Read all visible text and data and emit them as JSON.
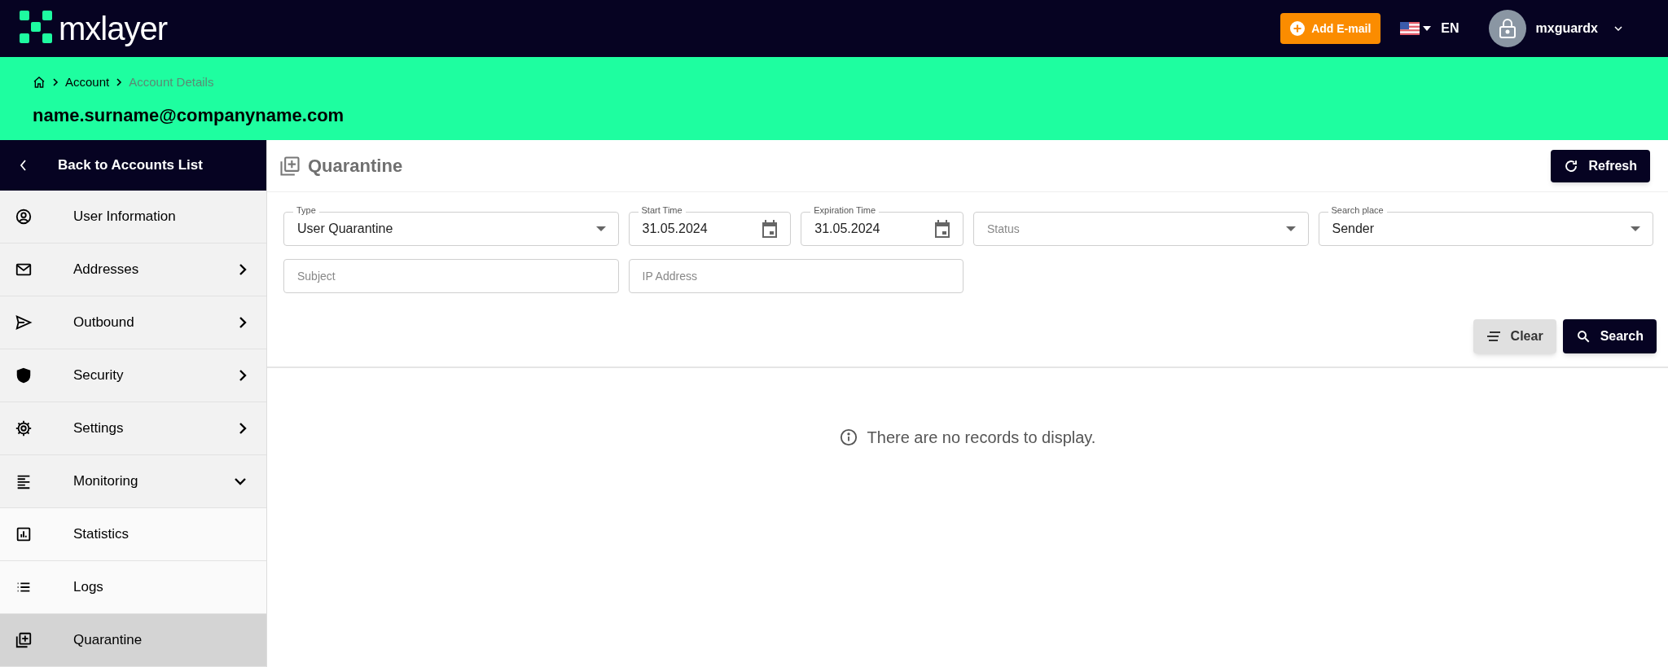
{
  "header": {
    "logo_text": "mxlayer",
    "add_email_button": "Add E-mail",
    "language": "EN",
    "user": "mxguardx"
  },
  "breadcrumb": [
    "Account",
    "Account Details"
  ],
  "account_email": "name.surname@companyname.com",
  "sidebar": {
    "back": "Back to Accounts List",
    "items": [
      {
        "label": "User Information",
        "kind": "plain",
        "selected": false
      },
      {
        "label": "Addresses",
        "kind": "submenu",
        "expanded": false,
        "selected": false
      },
      {
        "label": "Outbound",
        "kind": "submenu",
        "expanded": false,
        "selected": false
      },
      {
        "label": "Security",
        "kind": "submenu",
        "expanded": false,
        "selected": false
      },
      {
        "label": "Settings",
        "kind": "submenu",
        "expanded": false,
        "selected": false
      },
      {
        "label": "Monitoring",
        "kind": "submenu",
        "expanded": true,
        "selected": false,
        "children": [
          {
            "label": "Statistics",
            "selected": false
          },
          {
            "label": "Logs",
            "selected": false
          },
          {
            "label": "Quarantine",
            "selected": true
          }
        ]
      }
    ]
  },
  "page": {
    "title": "Quarantine",
    "refresh_button": "Refresh",
    "filters": [
      {
        "kind": "select",
        "label": "Type",
        "value": "User Quarantine"
      },
      {
        "kind": "date",
        "label": "Start Time",
        "value": "31.05.2024"
      },
      {
        "kind": "date",
        "label": "Expiration Time",
        "value": "31.05.2024"
      },
      {
        "kind": "select",
        "placeholder": "Status"
      },
      {
        "kind": "select",
        "label": "Search place",
        "value": "Sender"
      },
      {
        "kind": "text",
        "placeholder": "Subject"
      },
      {
        "kind": "text",
        "placeholder": "IP Address"
      }
    ],
    "clear_button": "Clear",
    "search_button": "Search",
    "empty_message": "There are no records to display."
  }
}
